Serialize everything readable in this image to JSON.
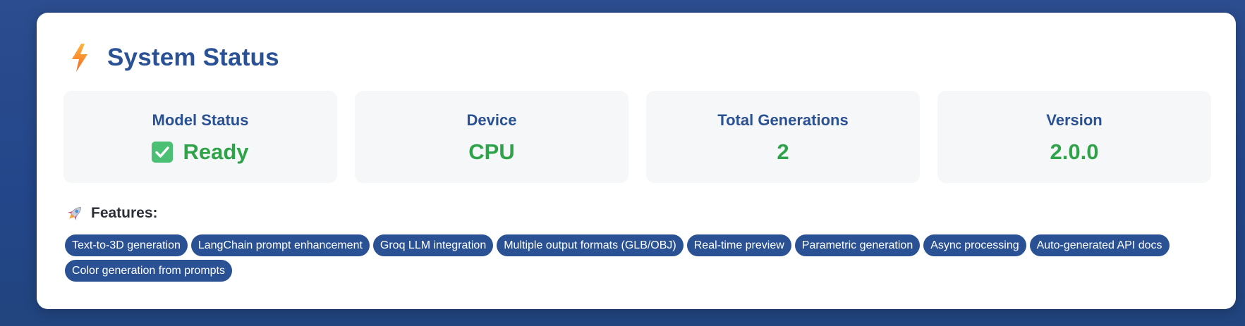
{
  "colors": {
    "background": "#23468a",
    "card": "#ffffff",
    "heading": "#2a5194",
    "value_green": "#2fa34a",
    "tag_bg": "#2a5194",
    "tag_text": "#ffffff",
    "stat_bg": "#f6f7f9"
  },
  "header": {
    "icon": "lightning-bolt-icon",
    "title": "System Status"
  },
  "stats": [
    {
      "label": "Model Status",
      "value": "Ready",
      "icon": "check-mark-icon"
    },
    {
      "label": "Device",
      "value": "CPU"
    },
    {
      "label": "Total Generations",
      "value": "2"
    },
    {
      "label": "Version",
      "value": "2.0.0"
    }
  ],
  "features": {
    "icon": "rocket-icon",
    "title": "Features:",
    "tags": [
      "Text-to-3D generation",
      "LangChain prompt enhancement",
      "Groq LLM integration",
      "Multiple output formats (GLB/OBJ)",
      "Real-time preview",
      "Parametric generation",
      "Async processing",
      "Auto-generated API docs",
      "Color generation from prompts"
    ]
  }
}
